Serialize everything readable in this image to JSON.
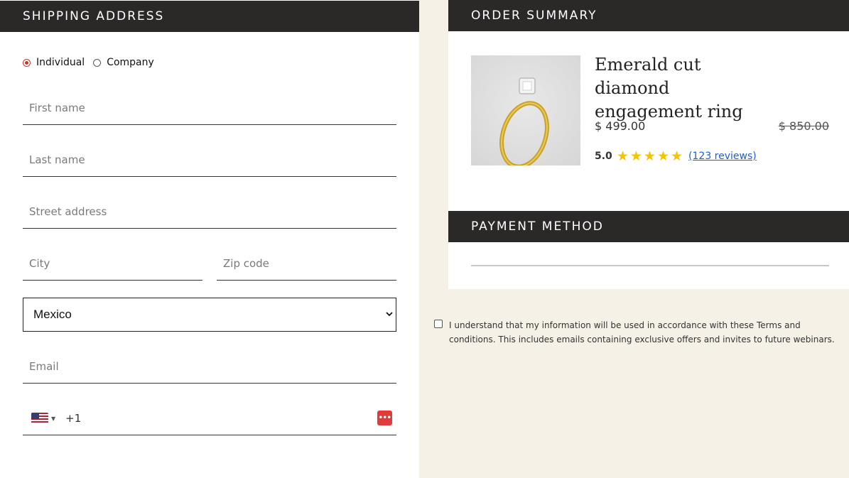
{
  "shipping": {
    "header": "SHIPPING ADDRESS",
    "customer_type": {
      "options": [
        "Individual",
        "Company"
      ],
      "selected": "Individual"
    },
    "fields": {
      "first_name": {
        "placeholder": "First name",
        "value": ""
      },
      "last_name": {
        "placeholder": "Last name",
        "value": ""
      },
      "street": {
        "placeholder": "Street address",
        "value": ""
      },
      "city": {
        "placeholder": "City",
        "value": ""
      },
      "zip": {
        "placeholder": "Zip code",
        "value": ""
      },
      "email": {
        "placeholder": "Email",
        "value": ""
      }
    },
    "country": {
      "selected": "Mexico",
      "chevron": "⌄"
    },
    "phone": {
      "flag": "us-flag-icon",
      "dial_code": "+1",
      "password_icon_text": "•••"
    }
  },
  "order": {
    "header": "ORDER SUMMARY",
    "product": {
      "title": "Emerald cut diamond engagement ring",
      "price": "$ 499.00",
      "original_price": "$ 850.00",
      "rating": "5.0",
      "stars": 5,
      "star_glyph": "★",
      "reviews": "(123 reviews)"
    }
  },
  "payment": {
    "header": "PAYMENT METHOD"
  },
  "terms": {
    "text": "I understand that my information will be used in accordance with these Terms and conditions. This includes emails containing exclusive offers and invites to future webinars.",
    "checked": false
  },
  "colors": {
    "header_bg": "#2b2828",
    "accent_red": "#c0392b",
    "star": "#f5c400",
    "link": "#1a5fd6",
    "page_bg": "#f5f1e7"
  }
}
